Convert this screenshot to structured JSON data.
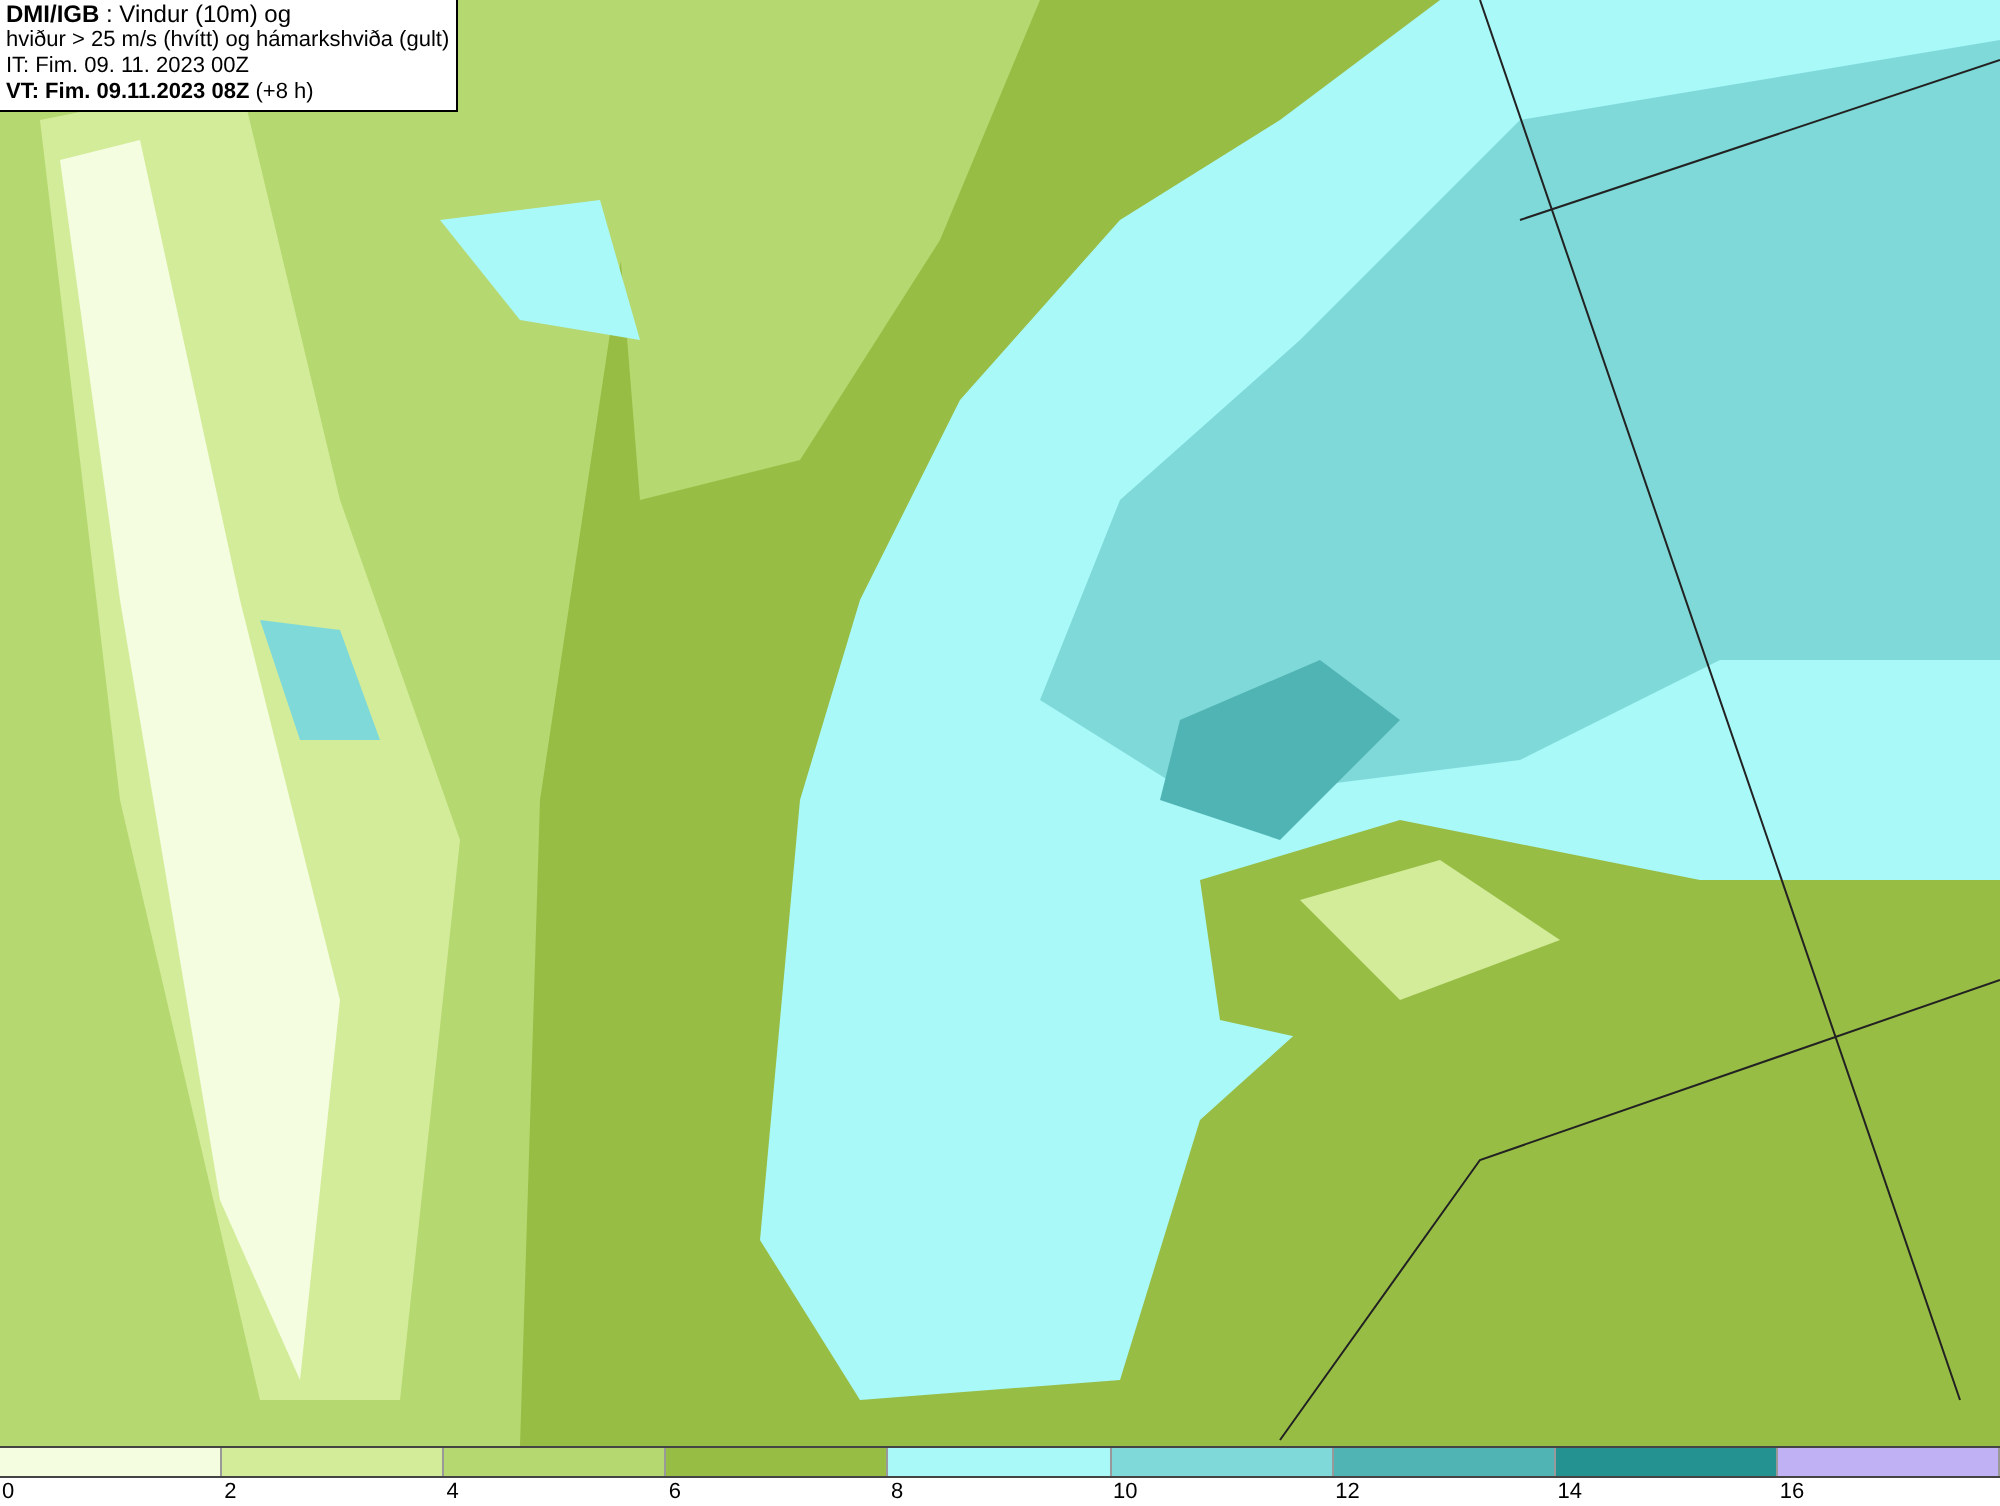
{
  "info_box": {
    "lines": [
      "**DMI/IGB** : Vindur (10m) og",
      "hviður > 25 m/s (hvítt) og hámarkshviða (gult)",
      "IT: Fim. 09. 11. 2023 00Z",
      "**VT: Fim. 09.11.2023 08Z** (+8 h)"
    ]
  },
  "legend": [
    {
      "label": "0",
      "color": "#f5fde0"
    },
    {
      "label": "2",
      "color": "#d3ec9a"
    },
    {
      "label": "4",
      "color": "#b6d870"
    },
    {
      "label": "6",
      "color": "#98bd45"
    },
    {
      "label": "8",
      "color": "#a9f9f9"
    },
    {
      "label": "10",
      "color": "#7fd9d8"
    },
    {
      "label": "12",
      "color": "#50b4b4"
    },
    {
      "label": "14",
      "color": "#259292"
    },
    {
      "label": "16",
      "color": "#c0b0f4"
    }
  ]
}
